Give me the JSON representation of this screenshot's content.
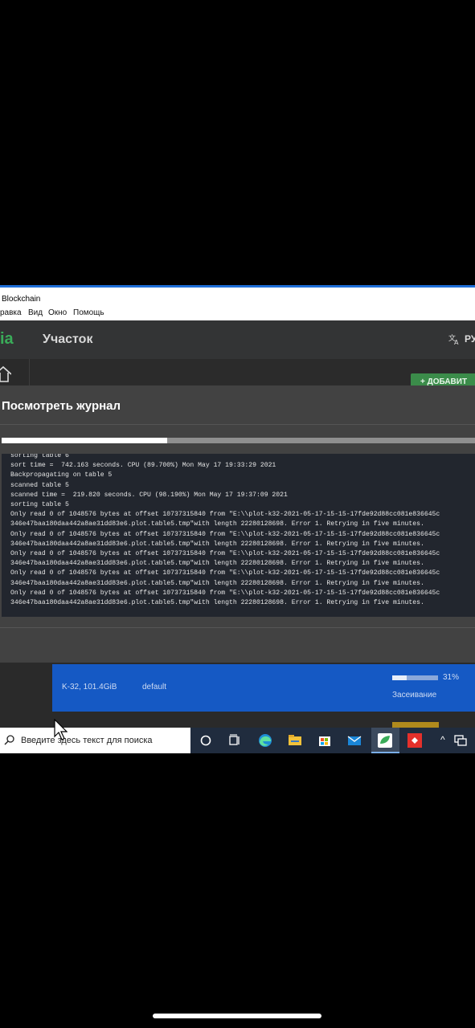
{
  "window": {
    "title": "Blockchain"
  },
  "menu": {
    "items": [
      "равка",
      "Вид",
      "Окно",
      "Помощь"
    ]
  },
  "app": {
    "logo": "ia",
    "page_title": "Участок",
    "language_label": "РУ",
    "add_button": "+ ДОБАВИТ"
  },
  "dialog": {
    "title": "Посмотреть журнал",
    "progress": 0.35,
    "log_lines": [
      "sorting table 6",
      "sort time =  742.163 seconds. CPU (89.700%) Mon May 17 19:33:29 2021",
      "Backpropagating on table 5",
      "scanned table 5",
      "scanned time =  219.820 seconds. CPU (98.190%) Mon May 17 19:37:09 2021",
      "sorting table 5",
      "Only read 0 of 1048576 bytes at offset 10737315840 from \"E:\\\\plot-k32-2021-05-17-15-15-17fde92d88cc081e836645c",
      "346e47baa180daa442a8ae31dd83e6.plot.table5.tmp\"with length 22280128698. Error 1. Retrying in five minutes.",
      "Only read 0 of 1048576 bytes at offset 10737315840 from \"E:\\\\plot-k32-2021-05-17-15-15-17fde92d88cc081e836645c",
      "346e47baa180daa442a8ae31dd83e6.plot.table5.tmp\"with length 22280128698. Error 1. Retrying in five minutes.",
      "Only read 0 of 1048576 bytes at offset 10737315840 from \"E:\\\\plot-k32-2021-05-17-15-15-17fde92d88cc081e836645c",
      "346e47baa180daa442a8ae31dd83e6.plot.table5.tmp\"with length 22280128698. Error 1. Retrying in five minutes.",
      "Only read 0 of 1048576 bytes at offset 10737315840 from \"E:\\\\plot-k32-2021-05-17-15-15-17fde92d88cc081e836645c",
      "346e47baa180daa442a8ae31dd83e6.plot.table5.tmp\"with length 22280128698. Error 1. Retrying in five minutes.",
      "Only read 0 of 1048576 bytes at offset 10737315840 from \"E:\\\\plot-k32-2021-05-17-15-15-17fde92d88cc081e836645c",
      "346e47baa180daa442a8ae31dd83e6.plot.table5.tmp\"with length 22280128698. Error 1. Retrying in five minutes."
    ]
  },
  "plot": {
    "size": "K-32, 101.4GiB",
    "pool": "default",
    "percent_label": "31%",
    "progress": 0.31,
    "status": "Засеивание"
  },
  "taskbar": {
    "search_placeholder": "Введите здесь текст для поиска",
    "apps": [
      "cortana-icon",
      "task-view-icon",
      "edge-icon",
      "file-explorer-icon",
      "store-icon",
      "mail-icon",
      "chia-icon",
      "anydesk-icon"
    ]
  },
  "colors": {
    "accent_green": "#3aac59",
    "plot_card_blue": "#1559c4",
    "taskbar": "#202c3e",
    "dialog": "#424242",
    "log_background": "#22262e"
  }
}
